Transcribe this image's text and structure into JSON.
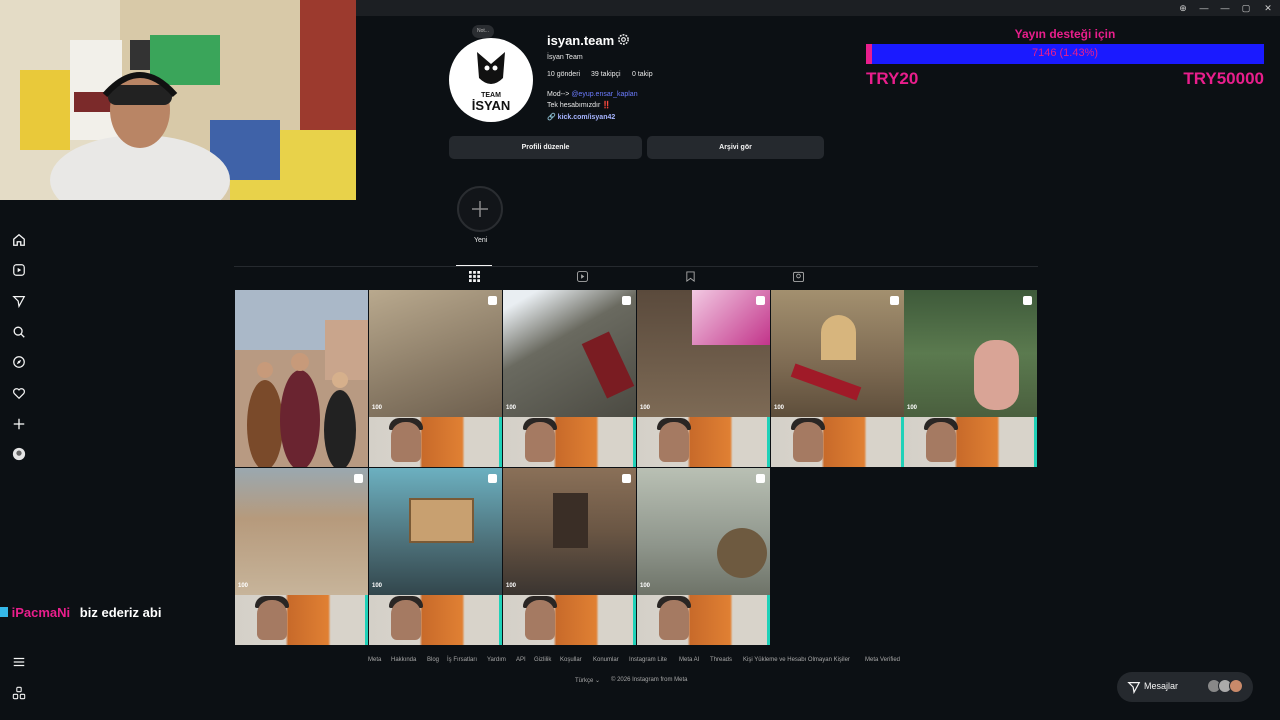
{
  "window": {
    "controls": [
      "⊕",
      "—",
      "▢",
      "✕",
      "—",
      "✕"
    ]
  },
  "profile": {
    "note": "Not...",
    "avatar_text": [
      "TEAM",
      "İSYAN"
    ],
    "username": "isyan.team",
    "full_name": "İsyan Team",
    "posts": "10 gönderi",
    "followers": "39 takipçi",
    "following": "0 takip",
    "bio_mod_prefix": "Mod-->",
    "bio_mod_handle": "@eyup.ensar_kaplan",
    "bio_line2": "Tek hesabımızdır ‼️",
    "link": "kick.com/isyan42",
    "edit_profile": "Profili düzenle",
    "view_archive": "Arşivi gör",
    "new_story": "Yeni"
  },
  "tiles": [
    {
      "hud": ""
    },
    {
      "hud": "100"
    },
    {
      "hud": "100"
    },
    {
      "hud": "100"
    },
    {
      "hud": "100"
    },
    {
      "hud": "100"
    },
    {
      "hud": "100"
    },
    {
      "hud": "100"
    },
    {
      "hud": "100"
    },
    {
      "hud": "100"
    }
  ],
  "footer": {
    "links": [
      "Meta",
      "Hakkında",
      "Blog",
      "İş Fırsatları",
      "Yardım",
      "API",
      "Gizlilik",
      "Koşullar",
      "Konumlar",
      "Instagram Lite",
      "Meta AI",
      "Threads",
      "Kişi Yükleme ve Hesabı Olmayan Kişiler",
      "Meta Verified"
    ],
    "language": "Türkçe",
    "copyright": "© 2026 Instagram from Meta"
  },
  "donation": {
    "title": "Yayın desteği için",
    "progress_text": "7146 (1.43%)",
    "progress_fraction": 0.0143,
    "min_label": "TRY20",
    "max_label": "TRY50000"
  },
  "chat": {
    "user": "iPacmaNi",
    "message": "biz ederiz abi"
  },
  "messages": {
    "label": "Mesajlar"
  },
  "colors": {
    "background": "#0c1014",
    "accent_link": "#6c7cff",
    "donation_pink": "#e91e8c",
    "donation_bar": "#1a1aff"
  }
}
